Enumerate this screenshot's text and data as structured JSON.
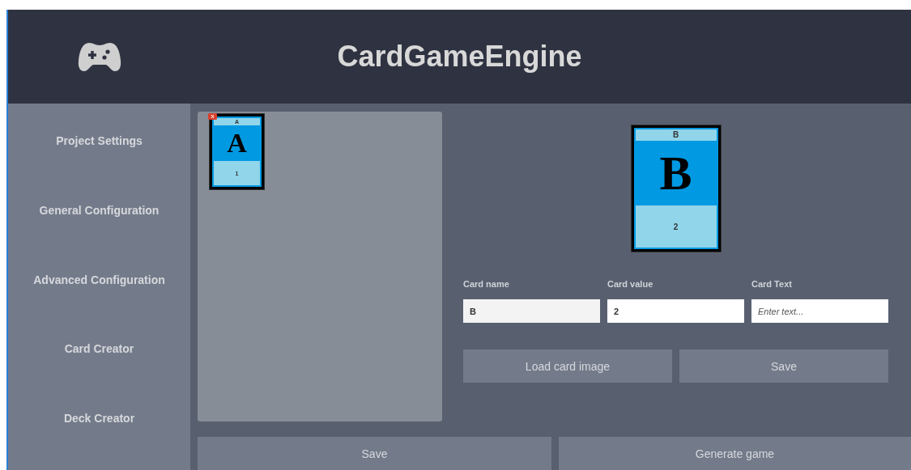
{
  "header": {
    "title": "CardGameEngine"
  },
  "sidebar": {
    "items": [
      {
        "label": "Project Settings"
      },
      {
        "label": "General Configuration"
      },
      {
        "label": "Advanced Configuration"
      },
      {
        "label": "Card Creator"
      },
      {
        "label": "Deck Creator"
      }
    ]
  },
  "canvas": {
    "cards": [
      {
        "name": "A",
        "symbol": "A",
        "value": "1",
        "removable": true
      }
    ]
  },
  "preview": {
    "name": "B",
    "symbol": "B",
    "value": "2"
  },
  "form": {
    "fields": [
      {
        "label": "Card name",
        "value": "B",
        "disabled": true
      },
      {
        "label": "Card value",
        "value": "2",
        "disabled": false
      },
      {
        "label": "Card Text",
        "placeholder": "Enter text...",
        "disabled": false
      }
    ],
    "buttons": [
      "Load card image",
      "Save"
    ]
  },
  "footer": {
    "buttons": [
      "Save",
      "Generate game"
    ]
  }
}
